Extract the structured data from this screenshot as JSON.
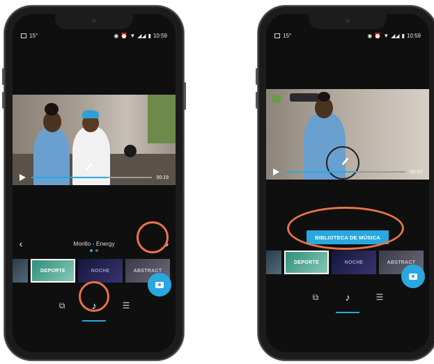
{
  "status_bar": {
    "temperature": "15°",
    "time": "10:59"
  },
  "player": {
    "left_time": "00:19",
    "right_time": "00:19",
    "left_progress": 0.62,
    "right_progress": 0.58
  },
  "song": {
    "title": "Morillo - Energy",
    "page": 1,
    "page_count": 2
  },
  "thumbnails": [
    {
      "label": ""
    },
    {
      "label": "DEPORTE"
    },
    {
      "label": "NOCHE"
    },
    {
      "label": "ABSTRACT"
    }
  ],
  "music_library_button": "BIBLIOTECA DE MÚSICA",
  "colors": {
    "accent": "#29a8e0",
    "highlight_ring": "#e8744a",
    "phone_body": "#1c1c1c"
  },
  "icons": {
    "prev": "chevron-left",
    "next": "chevron-right",
    "play": "play-triangle",
    "edit": "pencil",
    "fab": "camera",
    "nav": [
      "clip-add",
      "music-note",
      "sliders"
    ]
  }
}
